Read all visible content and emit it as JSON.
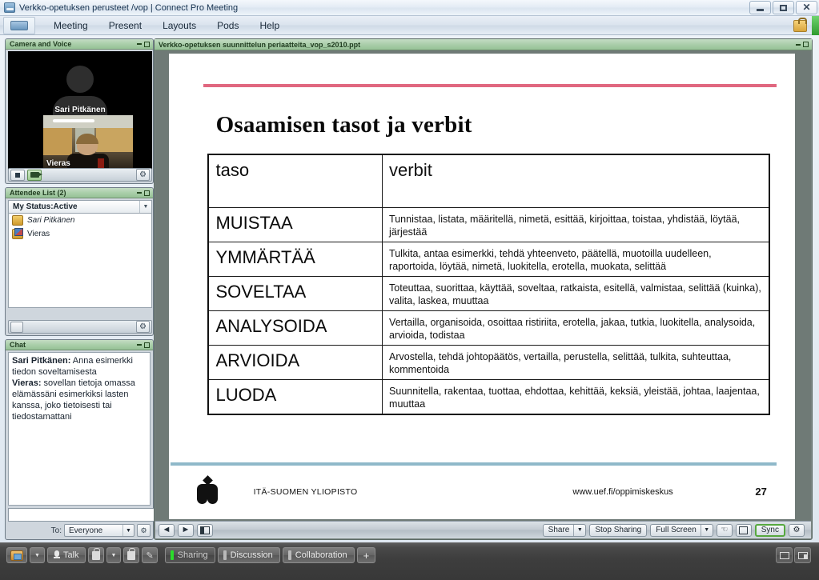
{
  "window": {
    "title": "Verkko-opetuksen perusteet /vop | Connect Pro Meeting",
    "app_icon": "connect-logo-icon",
    "minimize": "–",
    "maximize": "□",
    "close": "✕"
  },
  "menubar": {
    "items": [
      "Meeting",
      "Present",
      "Layouts",
      "Pods",
      "Help"
    ],
    "lock_icon": "secure-lock-icon"
  },
  "pods": {
    "camera": {
      "title": "Camera and Voice",
      "main_participant": "Sari Pitkänen",
      "thumb_participant": "Vieras",
      "stop_icon": "stop-square-icon",
      "webcam_icon": "webcam-icon",
      "gear_icon": "gear-icon"
    },
    "attendees": {
      "title": "Attendee List (2)",
      "status_label": "My Status:Active",
      "count": 2,
      "people": [
        {
          "name": "Sari Pitkänen",
          "role": "host",
          "icon": "host-icon"
        },
        {
          "name": "Vieras",
          "role": "presenter",
          "icon": "presenter-icon"
        }
      ],
      "gear_icon": "gear-icon"
    },
    "chat": {
      "title": "Chat",
      "messages": [
        {
          "from": "Sari Pitkänen:",
          "text": " Anna esimerkki tiedon soveltamisesta"
        },
        {
          "from": "Vieras:",
          "text": " sovellan tietoja omassa elämässäni esimerkiksi lasten kanssa, joko tietoisesti tai tiedostamattani"
        }
      ],
      "input_value": "",
      "input_placeholder": "",
      "send_icon": "enter-arrow-icon",
      "to_label": "To:",
      "to_value": "Everyone",
      "gear_icon": "gear-icon"
    },
    "share": {
      "title": "Verkko-opetuksen suunnittelun periaatteita_vop_s2010.ppt",
      "toolbar": {
        "prev": "◄",
        "next": "►",
        "layout_icon": "slide-layout-icon",
        "share_label": "Share",
        "stop_sharing_label": "Stop Sharing",
        "full_screen_label": "Full Screen",
        "pointer_icon": "pointer-icon",
        "draw_icon": "draw-icon",
        "sync_label": "Sync",
        "gear_icon": "gear-icon",
        "dropdown_glyph": "▼"
      }
    }
  },
  "slide": {
    "title": "Osaamisen tasot ja verbit",
    "table": {
      "header": {
        "level": "taso",
        "verbs": "verbit"
      },
      "rows": [
        {
          "level": "MUISTAA",
          "verbs": "Tunnistaa, listata, määritellä, nimetä, esittää, kirjoittaa, toistaa, yhdistää, löytää, järjestää"
        },
        {
          "level": "YMMÄRTÄÄ",
          "verbs": "Tulkita, antaa esimerkki, tehdä yhteenveto, päätellä, muotoilla uudelleen, raportoida, löytää, nimetä, luokitella, erotella, muokata, selittää"
        },
        {
          "level": "SOVELTAA",
          "verbs": "Toteuttaa, suorittaa, käyttää, soveltaa, ratkaista, esitellä, valmistaa, selittää (kuinka), valita, laskea, muuttaa"
        },
        {
          "level": "ANALYSOIDA",
          "verbs": "Vertailla, organisoida, osoittaa ristiriita, erotella, jakaa, tutkia, luokitella, analysoida, arvioida, todistaa"
        },
        {
          "level": "ARVIOIDA",
          "verbs": "Arvostella, tehdä johtopäätös, vertailla, perustella, selittää, tulkita, suhteuttaa, kommentoida"
        },
        {
          "level": "LUODA",
          "verbs": "Suunnitella, rakentaa, tuottaa, ehdottaa, kehittää, keksiä, yleistää, johtaa, laajentaa, muuttaa"
        }
      ]
    },
    "footer": {
      "org": "ITÄ-SUOMEN YLIOPISTO",
      "url": "www.uef.fi/oppimiskeskus",
      "page_number": "27",
      "logo_icon": "uef-leaf-logo-icon"
    },
    "colors": {
      "top_rule": "#e0677f",
      "bottom_rule": "#8fb8c9"
    }
  },
  "appbar": {
    "camera_share_icon": "camera-share-icon",
    "camera_dropdown": "▼",
    "talk_label": "Talk",
    "mic_icon": "microphone-icon",
    "lock_icon": "lock-icon",
    "talk_dropdown": "▼",
    "lock2_icon": "lock-icon",
    "pen_icon": "pen-icon",
    "layouts": [
      {
        "label": "Sharing",
        "active": true
      },
      {
        "label": "Discussion",
        "active": false
      },
      {
        "label": "Collaboration",
        "active": false
      }
    ],
    "add_label": "+",
    "right_icons": [
      "screen-icon",
      "notes-icon"
    ]
  }
}
